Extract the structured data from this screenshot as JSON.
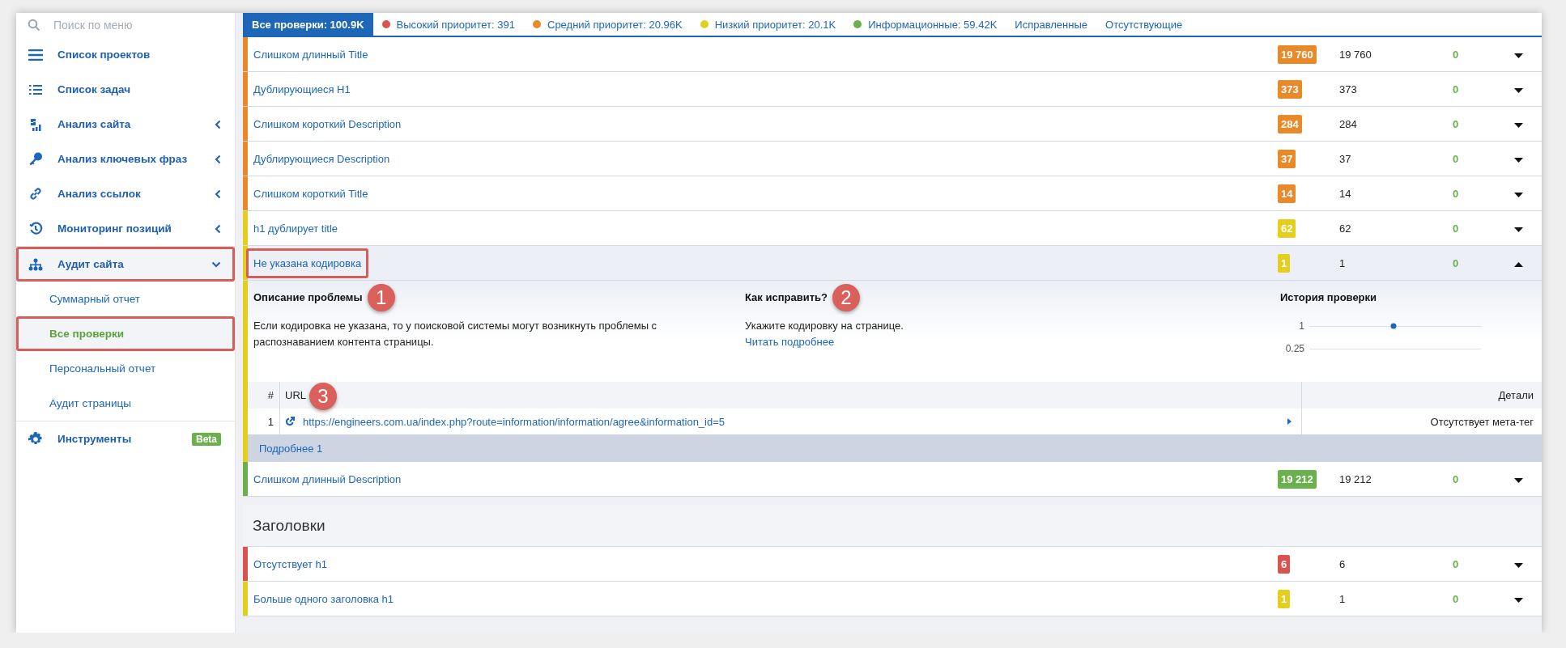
{
  "sidebar": {
    "search": {
      "placeholder": "Поиск по меню"
    },
    "items": [
      {
        "label": "Список проектов",
        "highlighted": false
      },
      {
        "label": "Список задач",
        "highlighted": false
      },
      {
        "label": "Анализ сайта",
        "expanded": false,
        "highlighted": false
      },
      {
        "label": "Анализ ключевых фраз",
        "expanded": false,
        "highlighted": false
      },
      {
        "label": "Анализ ссылок",
        "expanded": false,
        "highlighted": false
      },
      {
        "label": "Мониторинг позиций",
        "expanded": false,
        "highlighted": false
      },
      {
        "label": "Аудит сайта",
        "expanded": true,
        "highlighted": true,
        "children": [
          {
            "label": "Суммарный отчет",
            "selected": false,
            "highlighted": false
          },
          {
            "label": "Все проверки",
            "selected": true,
            "highlighted": true
          },
          {
            "label": "Персональный отчет",
            "selected": false,
            "highlighted": false
          },
          {
            "label": "Аудит страницы",
            "selected": false,
            "highlighted": false
          }
        ]
      },
      {
        "label": "Инструменты",
        "badge": "Beta",
        "highlighted": false
      }
    ]
  },
  "filters": [
    {
      "label": "Все проверки: 100.9K",
      "selected": true
    },
    {
      "label": "Высокий приоритет: 391",
      "selected": false,
      "color": "#d9534f"
    },
    {
      "label": "Средний приоритет: 20.96K",
      "selected": false,
      "color": "#e8892a"
    },
    {
      "label": "Низкий приоритет: 20.1K",
      "selected": false,
      "color": "#e4cf1f"
    },
    {
      "label": "Информационные: 59.42K",
      "selected": false,
      "color": "#6ab04c"
    },
    {
      "label": "Исправленные",
      "selected": false
    },
    {
      "label": "Отсутствующие",
      "selected": false
    }
  ],
  "groups": [
    {
      "rows": [
        {
          "name": "Слишком длинный Title",
          "badge": "19 760",
          "total": "19 760",
          "fixed": "0",
          "color": "#e8892a",
          "expanded": false,
          "highlighted": false
        },
        {
          "name": "Дублирующиеся H1",
          "badge": "373",
          "total": "373",
          "fixed": "0",
          "color": "#e8892a",
          "expanded": false,
          "highlighted": false
        },
        {
          "name": "Слишком короткий Description",
          "badge": "284",
          "total": "284",
          "fixed": "0",
          "color": "#e8892a",
          "expanded": false,
          "highlighted": false
        },
        {
          "name": "Дублирующиеся Description",
          "badge": "37",
          "total": "37",
          "fixed": "0",
          "color": "#e8892a",
          "expanded": false,
          "highlighted": false
        },
        {
          "name": "Слишком короткий Title",
          "badge": "14",
          "total": "14",
          "fixed": "0",
          "color": "#e8892a",
          "expanded": false,
          "highlighted": false
        },
        {
          "name": "h1 дублирует title",
          "badge": "62",
          "total": "62",
          "fixed": "0",
          "color": "#e4cf1f",
          "expanded": false,
          "highlighted": false
        },
        {
          "name": "Не указана кодировка",
          "badge": "1",
          "total": "1",
          "fixed": "0",
          "color": "#e4cf1f",
          "expanded": true,
          "highlighted": true,
          "details": {
            "description": {
              "heading": "Описание проблемы",
              "callout": "1",
              "text": "Если кодировка не указана, то у поисковой системы могут возникнуть проблемы с распознаванием контента страницы."
            },
            "fix": {
              "heading": "Как исправить?",
              "callout": "2",
              "text": "Укажите кодировку на странице.",
              "link": "Читать подробнее"
            },
            "history": {
              "heading": "История проверки",
              "chart_data": {
                "type": "line",
                "marker": true,
                "ylim": [
                  0.25,
                  1
                ],
                "yticks": [
                  1,
                  0.25
                ],
                "values": [
                  1
                ]
              }
            },
            "urls": {
              "columns": [
                "#",
                "URL",
                "Детали"
              ],
              "callout": "3",
              "rows": [
                {
                  "index": "1",
                  "url": "https://engineers.com.ua/index.php?route=information/information/agree&information_id=5",
                  "details": "Отсутствует мета-тег"
                }
              ],
              "more": "Подробнее 1"
            }
          }
        },
        {
          "name": "Слишком длинный Description",
          "badge": "19 212",
          "total": "19 212",
          "fixed": "0",
          "color": "#6ab04c",
          "expanded": false,
          "highlighted": false
        }
      ]
    },
    {
      "title": "Заголовки",
      "rows": [
        {
          "name": "Отсутствует h1",
          "badge": "6",
          "total": "6",
          "fixed": "0",
          "color": "#d9534f",
          "expanded": false,
          "highlighted": false
        },
        {
          "name": "Больше одного заголовка h1",
          "badge": "1",
          "total": "1",
          "fixed": "0",
          "color": "#e4cf1f",
          "expanded": false,
          "highlighted": false
        }
      ]
    }
  ]
}
